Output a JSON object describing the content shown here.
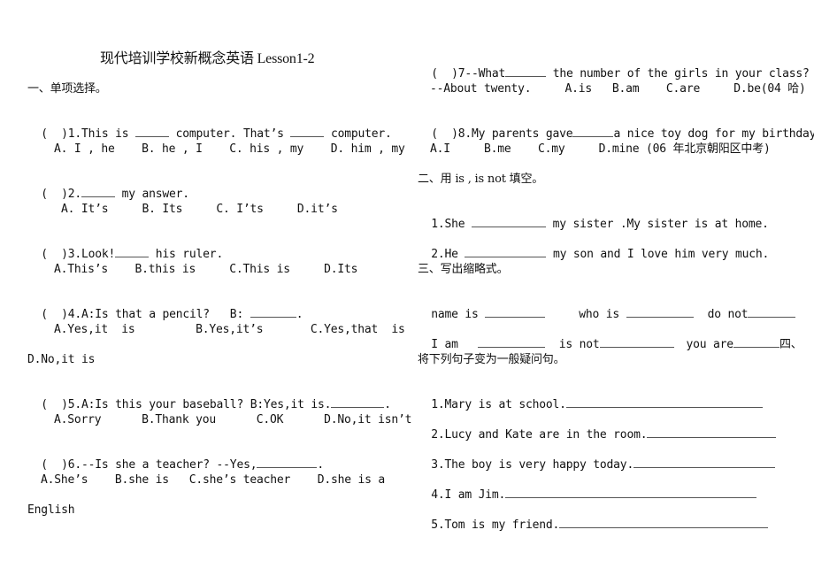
{
  "title": "现代培训学校新概念英语 Lesson1-2",
  "left": {
    "section1_heading": "一、单项选择。",
    "q1": {
      "stem_a": "(  )1.This is ",
      "stem_b": " computer. That’s ",
      "stem_c": " computer.",
      "options": "A. I , he    B. he , I    C. his , my    D. him , my"
    },
    "q2": {
      "stem_a": "(  )2.",
      "stem_b": " my answer.",
      "options": "A. It’s     B. Its     C. I’ts     D.it’s"
    },
    "q3": {
      "stem_a": "(  )3.Look!",
      "stem_b": " his ruler.",
      "options": "A.This’s    B.this is     C.This is     D.Its"
    },
    "q4": {
      "stem_a": "(  )4.A:Is that a pencil?   B: ",
      "stem_b": ".",
      "options": "A.Yes,it  is         B.Yes,it’s       C.Yes,that  is",
      "options_wrap": "D.No,it is"
    },
    "q5": {
      "stem_a": "(  )5.A:Is this your baseball? B:Yes,it is.",
      "stem_b": ".",
      "options": "A.Sorry      B.Thank you      C.OK      D.No,it isn’t"
    },
    "q6": {
      "stem_a": "(  )6.--Is she a teacher? --Yes,",
      "stem_b": ".",
      "options": "A.She’s    B.she is   C.she’s teacher    D.she is a",
      "options_wrap": "English"
    }
  },
  "right": {
    "q7": {
      "stem_a": "(  )7--What",
      "stem_b": " the number of the girls in your class?",
      "options": "--About twenty.     A.is   B.am    C.are     D.be(04 哈)"
    },
    "q8": {
      "stem_a": "(  )8.My parents gave",
      "stem_b": "a nice toy dog for my birthday.",
      "options": "A.I     B.me    C.my     D.mine (06 年北京朝阳区中考)"
    },
    "section2_heading": "二、用 is , is not 填空。",
    "fill1": {
      "a": "1.She ",
      "b": " my sister .My sister is at home."
    },
    "fill2": {
      "a": "2.He ",
      "b": " my son and I love him very much."
    },
    "section3_heading": "三、写出缩略式。",
    "abbr_row1": {
      "a": "name is ",
      "b": "who is ",
      "c": "do not"
    },
    "abbr_row2": {
      "a": "I am",
      "b": "is not",
      "c": "you are",
      "d": "四、"
    },
    "section4_heading": "将下列句子变为一般疑问句。",
    "sentences": [
      "1.Mary is at school.",
      "2.Lucy and Kate are in the room.",
      "3.The boy is very happy today.",
      "4.I am Jim.",
      "5.Tom is my friend."
    ]
  }
}
